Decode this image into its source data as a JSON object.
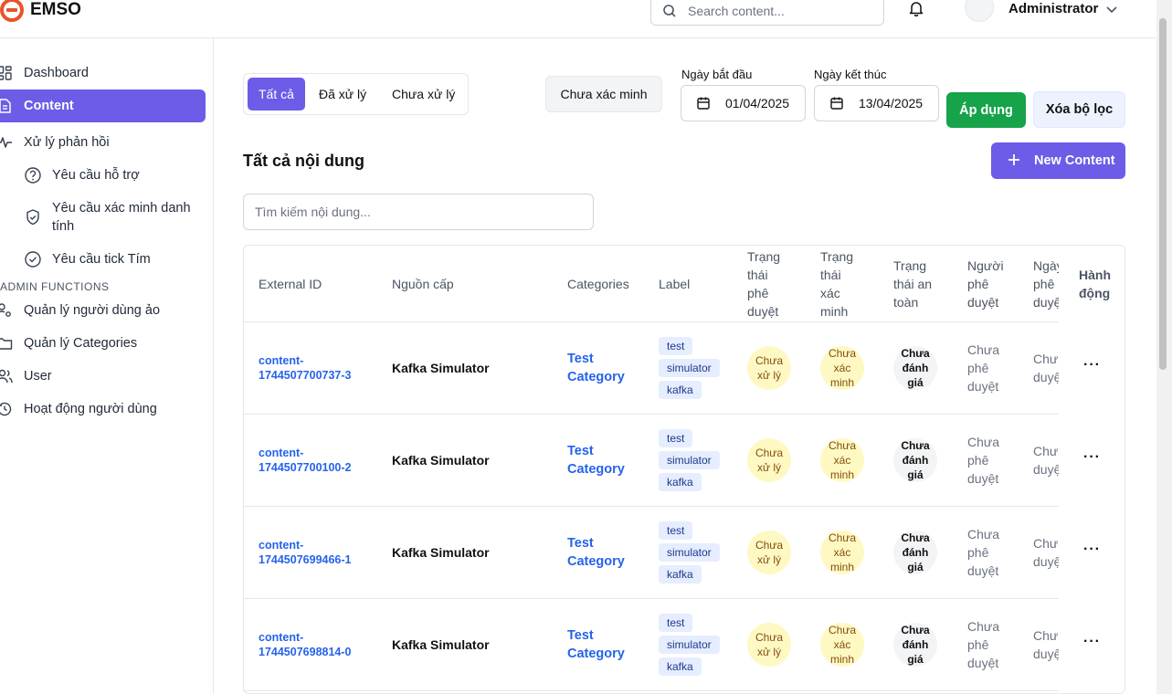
{
  "header": {
    "brand": "EMSO",
    "search_placeholder": "Search content...",
    "user_name": "Administrator"
  },
  "sidebar": {
    "items": [
      {
        "label": "Dashboard",
        "icon": "dashboard-icon"
      },
      {
        "label": "Content",
        "icon": "document-icon",
        "active": true
      },
      {
        "label": "Xử lý phản hồi",
        "icon": "activity-icon"
      }
    ],
    "sub_items": [
      {
        "label": "Yêu cầu hỗ trợ",
        "icon": "help-circle-icon"
      },
      {
        "label": "Yêu cầu xác minh danh tính",
        "icon": "shield-check-icon"
      },
      {
        "label": "Yêu cầu tick Tím",
        "icon": "check-circle-icon"
      }
    ],
    "section_label": "ADMIN FUNCTIONS",
    "admin_items": [
      {
        "label": "Quản lý người dùng ảo",
        "icon": "users-cog-icon"
      },
      {
        "label": "Quản lý Categories",
        "icon": "folder-icon"
      },
      {
        "label": "User",
        "icon": "users-icon"
      },
      {
        "label": "Hoạt động người dùng",
        "icon": "history-icon"
      }
    ]
  },
  "filters": {
    "tabs": [
      "Tất cả",
      "Đã xử lý",
      "Chưa xử lý"
    ],
    "active_tab": "Tất cả",
    "unverified_button": "Chưa xác minh",
    "start_date_label": "Ngày bắt đầu",
    "start_date": "01/04/2025",
    "end_date_label": "Ngày kết thúc",
    "end_date": "13/04/2025",
    "apply_button": "Áp dụng",
    "clear_button": "Xóa bộ lọc"
  },
  "main": {
    "heading": "Tất cả nội dung",
    "new_button": "New Content",
    "search_placeholder": "Tìm kiếm nội dung..."
  },
  "table": {
    "headers": {
      "external_id": "External ID",
      "source": "Nguồn cấp",
      "categories": "Categories",
      "label": "Label",
      "approval_status": [
        "Trạng",
        "thái",
        "phê",
        "duyệt"
      ],
      "verification_status": [
        "Trạng",
        "thái",
        "xác",
        "minh"
      ],
      "safety_status": [
        "Trạng",
        "thái an",
        "toàn"
      ],
      "approver": [
        "Người",
        "phê",
        "duyệt"
      ],
      "date": [
        "Ngày",
        "phê",
        "duyệt"
      ],
      "action": [
        "Hành",
        "động"
      ]
    },
    "rows": [
      {
        "external_id": [
          "content-",
          "1744507700737-3"
        ],
        "source": "Kafka Simulator",
        "category": [
          "Test",
          "Category"
        ],
        "tags": [
          "test",
          "simulator",
          "kafka"
        ],
        "approval": [
          "Chưa",
          "xử lý"
        ],
        "verification": [
          "Chưa",
          "xác",
          "minh"
        ],
        "safety": [
          "Chưa",
          "đánh",
          "giá"
        ],
        "approver": [
          "Chưa",
          "phê",
          "duyệt"
        ],
        "date": [
          "Chưa",
          "duyệ"
        ],
        "action": "···"
      },
      {
        "external_id": [
          "content-",
          "1744507700100-2"
        ],
        "source": "Kafka Simulator",
        "category": [
          "Test",
          "Category"
        ],
        "tags": [
          "test",
          "simulator",
          "kafka"
        ],
        "approval": [
          "Chưa",
          "xử lý"
        ],
        "verification": [
          "Chưa",
          "xác",
          "minh"
        ],
        "safety": [
          "Chưa",
          "đánh",
          "giá"
        ],
        "approver": [
          "Chưa",
          "phê",
          "duyệt"
        ],
        "date": [
          "Chưa",
          "duyệ"
        ],
        "action": "···"
      },
      {
        "external_id": [
          "content-",
          "1744507699466-1"
        ],
        "source": "Kafka Simulator",
        "category": [
          "Test",
          "Category"
        ],
        "tags": [
          "test",
          "simulator",
          "kafka"
        ],
        "approval": [
          "Chưa",
          "xử lý"
        ],
        "verification": [
          "Chưa",
          "xác",
          "minh"
        ],
        "safety": [
          "Chưa",
          "đánh",
          "giá"
        ],
        "approver": [
          "Chưa",
          "phê",
          "duyệt"
        ],
        "date": [
          "Chưa",
          "duyệ"
        ],
        "action": "···"
      },
      {
        "external_id": [
          "content-",
          "1744507698814-0"
        ],
        "source": "Kafka Simulator",
        "category": [
          "Test",
          "Category"
        ],
        "tags": [
          "test",
          "simulator",
          "kafka"
        ],
        "approval": [
          "Chưa",
          "xử lý"
        ],
        "verification": [
          "Chưa",
          "xác",
          "minh"
        ],
        "safety": [
          "Chưa",
          "đánh",
          "giá"
        ],
        "approver": [
          "Chưa",
          "phê",
          "duyệt"
        ],
        "date": [
          "Chưa",
          "duyệ"
        ],
        "action": "···"
      }
    ]
  },
  "colors": {
    "primary": "#6c5ce7",
    "apply": "#16a34a",
    "link": "#2563eb",
    "badge_yellow": "#fef9c3",
    "badge_gray": "#f3f4f6"
  }
}
